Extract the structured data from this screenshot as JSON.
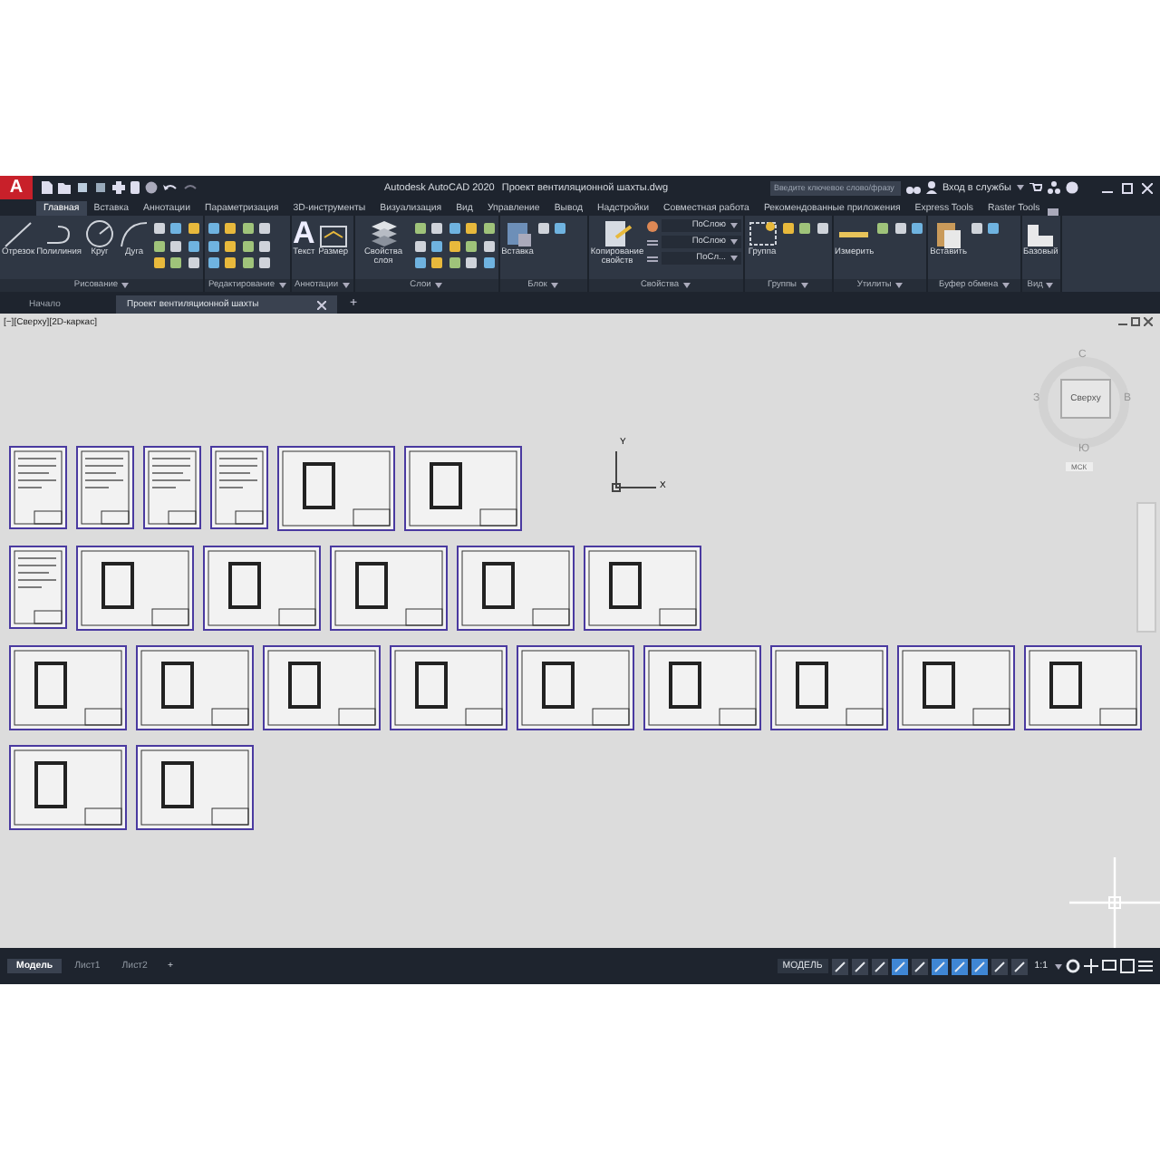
{
  "title_bar": {
    "logo": "A",
    "app_title": "Autodesk AutoCAD 2020",
    "file_title": "Проект вентиляционной шахты.dwg",
    "search": {
      "placeholder": "Введите ключевое слово/фразу"
    },
    "sign_in": "Вход в службы"
  },
  "ribbon": {
    "tabs": [
      {
        "label": "Главная",
        "selected": true
      },
      {
        "label": "Вставка",
        "selected": false
      },
      {
        "label": "Аннотации",
        "selected": false
      },
      {
        "label": "Параметризация",
        "selected": false
      },
      {
        "label": "3D-инструменты",
        "selected": false
      },
      {
        "label": "Визуализация",
        "selected": false
      },
      {
        "label": "Вид",
        "selected": false
      },
      {
        "label": "Управление",
        "selected": false
      },
      {
        "label": "Вывод",
        "selected": false
      },
      {
        "label": "Надстройки",
        "selected": false
      },
      {
        "label": "Совместная работа",
        "selected": false
      },
      {
        "label": "Рекомендованные приложения",
        "selected": false
      },
      {
        "label": "Express Tools",
        "selected": false
      },
      {
        "label": "Raster Tools",
        "selected": false
      }
    ],
    "panels": [
      {
        "title": "Рисование",
        "tools": [
          {
            "label": "Отрезок",
            "kind": "line"
          },
          {
            "label": "Полилиния",
            "kind": "polyline"
          },
          {
            "label": "Круг",
            "kind": "circle"
          },
          {
            "label": "Дуга",
            "kind": "arc"
          }
        ]
      },
      {
        "title": "Редактирование"
      },
      {
        "title": "Аннотации",
        "tools": [
          {
            "label": "Текст",
            "kind": "text",
            "glyph": "A"
          },
          {
            "label": "Размер",
            "kind": "dimension"
          }
        ]
      },
      {
        "title": "Слои",
        "tools": [
          {
            "label": "Свойства слоя",
            "kind": "layers"
          }
        ]
      },
      {
        "title": "Блок",
        "tools": [
          {
            "label": "Вставка",
            "kind": "insert"
          }
        ]
      },
      {
        "title": "Свойства",
        "tools": [
          {
            "label": "Копирование свойств",
            "kind": "match"
          }
        ],
        "dropdowns": [
          "ПоСлою",
          "ПоСлою",
          "ПоСл..."
        ]
      },
      {
        "title": "Группы",
        "tools": [
          {
            "label": "Группа",
            "kind": "group"
          }
        ]
      },
      {
        "title": "Утилиты",
        "tools": [
          {
            "label": "Измерить",
            "kind": "measure"
          }
        ]
      },
      {
        "title": "Буфер обмена",
        "tools": [
          {
            "label": "Вставить",
            "kind": "paste"
          }
        ]
      },
      {
        "title": "Вид",
        "tools": [
          {
            "label": "Базовый",
            "kind": "base"
          }
        ]
      }
    ]
  },
  "file_tabs": {
    "tabs": [
      {
        "label": "Начало",
        "selected": false,
        "closable": false
      },
      {
        "label": "Проект вентиляционной шахты",
        "selected": true,
        "closable": true
      }
    ],
    "new_tab": "+"
  },
  "viewport": {
    "label": "[−][Сверху][2D-каркас]",
    "viewcube": {
      "top": "Сверху",
      "north": "С",
      "south": "Ю",
      "east": "В",
      "west": "З",
      "ucs": "МСК"
    },
    "ucs_icon": {
      "x": "X",
      "y": "Y"
    },
    "sheet_rows": [
      [
        {
          "kind": "portrait"
        },
        {
          "kind": "portrait"
        },
        {
          "kind": "portrait"
        },
        {
          "kind": "portrait"
        },
        {
          "kind": "landscape"
        },
        {
          "kind": "landscape"
        }
      ],
      [
        {
          "kind": "portrait"
        },
        {
          "kind": "landscape"
        },
        {
          "kind": "landscape"
        },
        {
          "kind": "landscape"
        },
        {
          "kind": "landscape"
        },
        {
          "kind": "landscape"
        }
      ],
      [
        {
          "kind": "landscape"
        },
        {
          "kind": "landscape"
        },
        {
          "kind": "landscape"
        },
        {
          "kind": "landscape"
        },
        {
          "kind": "landscape"
        },
        {
          "kind": "landscape"
        },
        {
          "kind": "landscape"
        },
        {
          "kind": "landscape"
        },
        {
          "kind": "landscape"
        }
      ],
      [
        {
          "kind": "landscape"
        },
        {
          "kind": "landscape"
        }
      ]
    ]
  },
  "status_bar": {
    "layout_tabs": [
      {
        "label": "Модель",
        "selected": true
      },
      {
        "label": "Лист1",
        "selected": false
      },
      {
        "label": "Лист2",
        "selected": false
      }
    ],
    "new_tab": "+",
    "mode": "МОДЕЛЬ",
    "scale": "1:1",
    "toggles": [
      {
        "on": false
      },
      {
        "on": false
      },
      {
        "on": false
      },
      {
        "on": true
      },
      {
        "on": false
      },
      {
        "on": true
      },
      {
        "on": true
      },
      {
        "on": true
      },
      {
        "on": false
      },
      {
        "on": false
      }
    ]
  }
}
